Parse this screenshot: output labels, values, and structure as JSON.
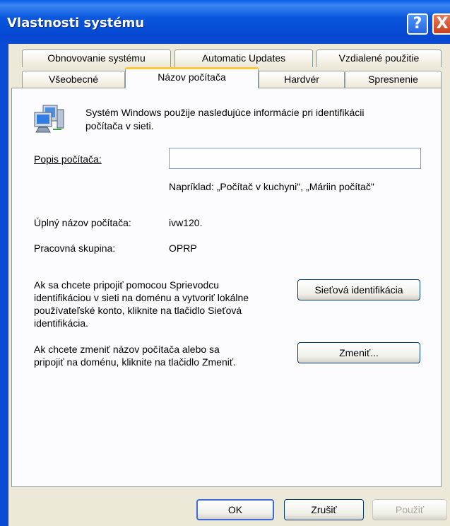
{
  "window": {
    "title": "Vlastnosti systému",
    "help_icon": "?",
    "close_icon": "X"
  },
  "tabs_row1": [
    "Obnovovanie systému",
    "Automatic Updates",
    "Vzdialené použitie"
  ],
  "tabs_row2": [
    "Všeobecné",
    "Názov počítača",
    "Hardvér",
    "Spresnenie"
  ],
  "info": {
    "line1": "Systém Windows použije nasledujúce informácie pri identifikácii",
    "line2": "počítača v sieti."
  },
  "description": {
    "label": "Popis počítača:",
    "value": "",
    "example": "Napríklad: „Počítač v kuchyni\", „Máriin počítač\""
  },
  "full_name": {
    "label": "Úplný názov počítača:",
    "value": "ivw120."
  },
  "workgroup": {
    "label": "Pracovná skupina:",
    "value": "OPRP"
  },
  "network_id": {
    "lines": [
      "Ak sa chcete pripojiť pomocou Sprievodcu",
      "identifikáciou v sieti na doménu a vytvoriť lokálne",
      "používateľské konto, kliknite na tlačidlo Sieťová",
      "identifikácia."
    ],
    "button": "Sieťová identifikácia"
  },
  "change": {
    "lines": [
      "Ak chcete zmeniť názov počítača alebo sa",
      "pripojiť na doménu, kliknite na tlačidlo Zmeniť."
    ],
    "button": "Zmeniť..."
  },
  "buttons": {
    "ok": "OK",
    "cancel": "Zrušiť",
    "apply": "Použiť"
  }
}
